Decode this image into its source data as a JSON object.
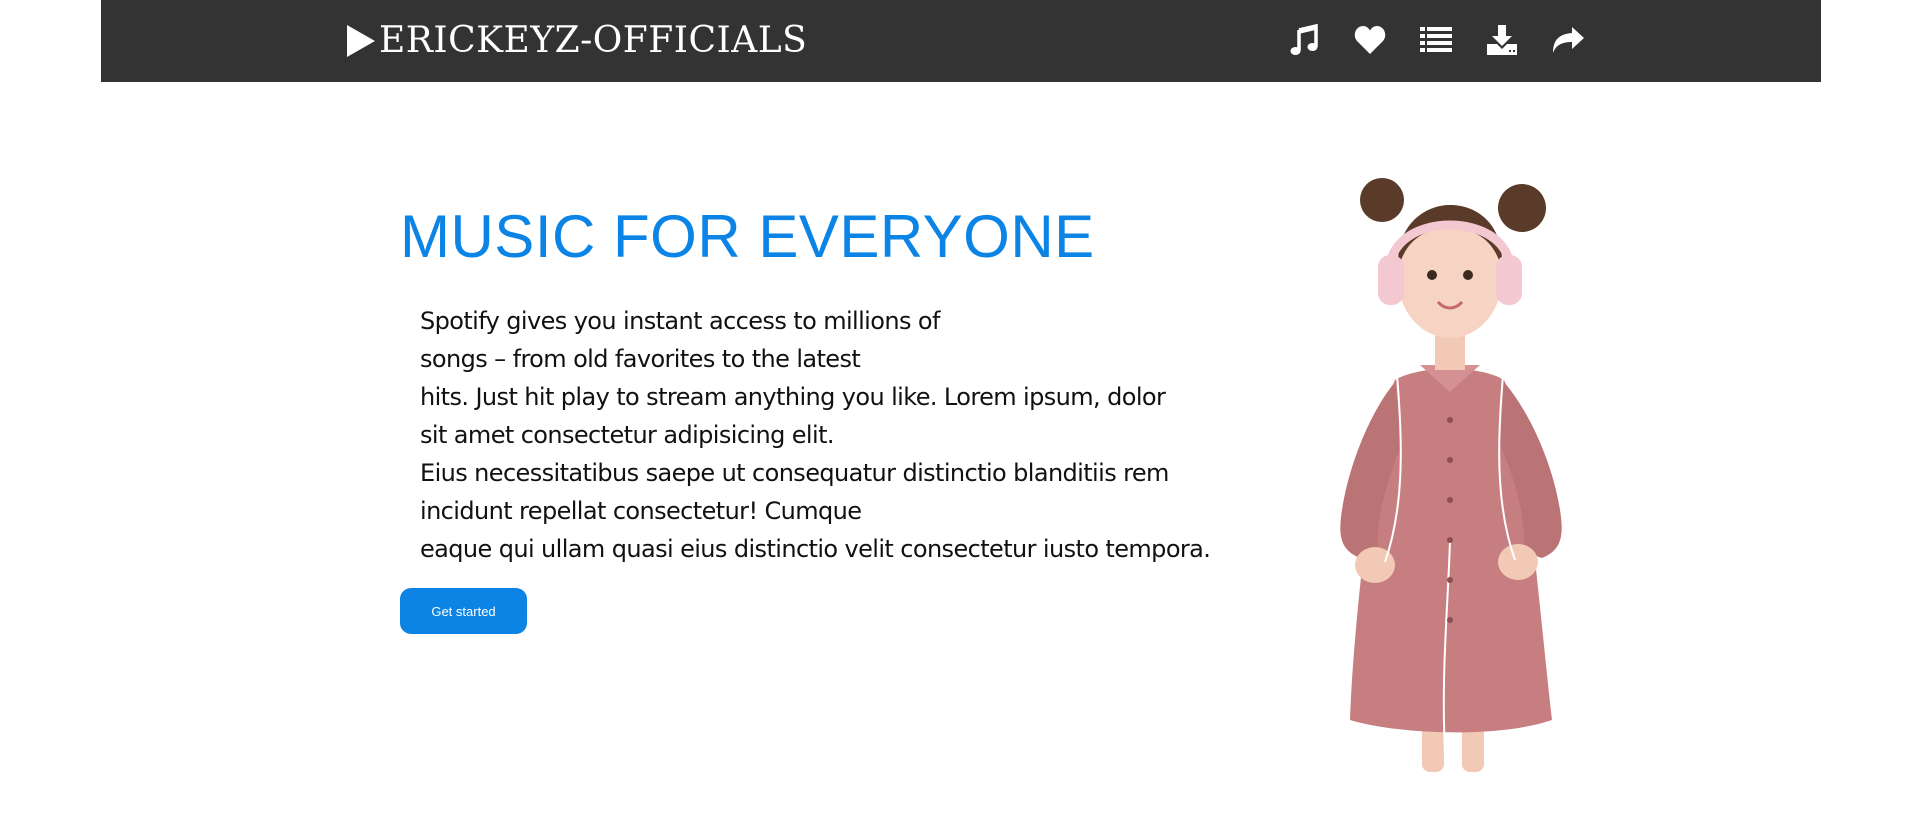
{
  "header": {
    "brand_text": "ERICKEYZ-OFFICIALS",
    "brand_icon": "play-triangle-icon",
    "icons": [
      "music-note-icon",
      "heart-icon",
      "list-icon",
      "download-icon",
      "share-arrow-icon"
    ],
    "background_color": "#333333"
  },
  "hero": {
    "title": "MUSIC FOR EVERYONE",
    "lines": [
      "Spotify gives you instant access to millions of",
      "songs – from old favorites to the latest",
      "hits. Just hit play to stream anything you like. Lorem ipsum, dolor",
      "sit amet consectetur adipisicing elit.",
      "Eius necessitatibus saepe ut consequatur distinctio blanditiis rem",
      "incidunt repellat consectetur! Cumque",
      "eaque qui ullam quasi eius distinctio velit consectetur iusto tempora."
    ],
    "button_label": "Get started",
    "accent_color": "#0b84e6"
  }
}
